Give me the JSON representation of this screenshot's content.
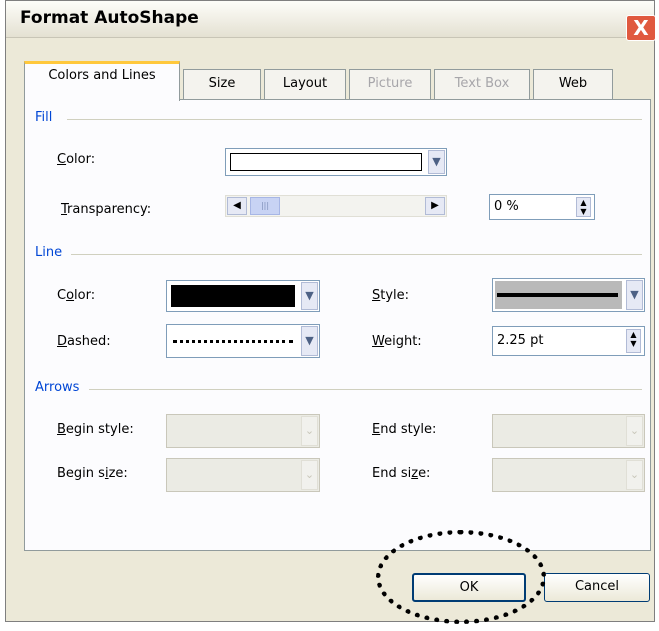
{
  "window": {
    "title": "Format AutoShape",
    "close_icon": "X"
  },
  "tabs": [
    {
      "label": "Colors and Lines",
      "state": "active"
    },
    {
      "label": "Size",
      "state": "normal"
    },
    {
      "label": "Layout",
      "state": "normal"
    },
    {
      "label": "Picture",
      "state": "disabled"
    },
    {
      "label": "Text Box",
      "state": "disabled"
    },
    {
      "label": "Web",
      "state": "normal"
    }
  ],
  "fill": {
    "heading": "Fill",
    "color_label": "Color:",
    "color_value": "#ffffff",
    "transparency_label": "Transparency:",
    "transparency_value": "0 %",
    "transparency_fraction": 0
  },
  "line": {
    "heading": "Line",
    "color_label": "Color:",
    "color_value": "#000000",
    "style_label": "Style:",
    "dashed_label": "Dashed:",
    "weight_label": "Weight:",
    "weight_value": "2.25 pt"
  },
  "arrows": {
    "heading": "Arrows",
    "begin_style_label": "Begin style:",
    "end_style_label": "End style:",
    "begin_size_label": "Begin size:",
    "end_size_label": "End size:"
  },
  "buttons": {
    "ok": "OK",
    "cancel": "Cancel"
  },
  "colors": {
    "group_heading": "#0046d5",
    "close_button": "#e0593f",
    "active_tab_accent": "#ffc83c"
  }
}
